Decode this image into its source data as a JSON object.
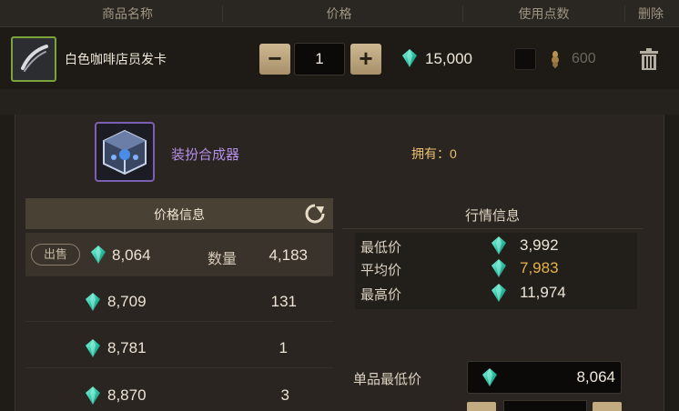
{
  "cart": {
    "headers": {
      "name": "商品名称",
      "price": "价格",
      "points": "使用点数",
      "delete": "删除"
    },
    "item": {
      "icon": "hair-card-icon",
      "name": "白色咖啡店员发卡",
      "quantity": "1",
      "minus": "−",
      "plus": "+",
      "price": "15,000",
      "points": "600"
    }
  },
  "synth": {
    "icon": "cube-icon",
    "name": "装扮合成器",
    "owned": "拥有：0"
  },
  "price_info": {
    "title": "价格信息",
    "sell_label": "出售",
    "qty_label": "数量",
    "rows": [
      {
        "price": "8,064",
        "qty": "4,183"
      },
      {
        "price": "8,709",
        "qty": "131"
      },
      {
        "price": "8,781",
        "qty": "1"
      },
      {
        "price": "8,870",
        "qty": "3"
      }
    ]
  },
  "market_info": {
    "title": "行情信息",
    "lowest_label": "最低价",
    "lowest": "3,992",
    "average_label": "平均价",
    "average": "7,983",
    "highest_label": "最高价",
    "highest": "11,974"
  },
  "single_min": {
    "label": "单品最低价",
    "value": "8,064"
  },
  "colors": {
    "gem": "#3fd0b5",
    "accent_gold": "#e6b24a",
    "synth_purple": "#b58fe8"
  }
}
